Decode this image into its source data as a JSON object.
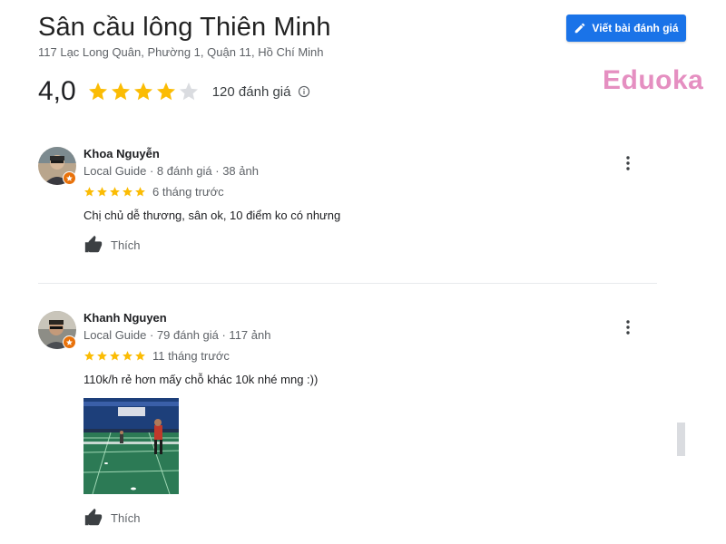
{
  "place": {
    "title": "Sân cầu lông Thiên Minh",
    "address": "117 Lạc Long Quân, Phường 1, Quận 11, Hồ Chí Minh",
    "rating": "4,0",
    "rating_value": 4.0,
    "review_count": "120 đánh giá"
  },
  "actions": {
    "write_review_label": "Viết bài đánh giá"
  },
  "watermark": "Eduoka",
  "reviews": [
    {
      "name": "Khoa Nguyễn",
      "meta": "Local Guide · 8 đánh giá · 38 ảnh",
      "stars": 5,
      "time": "6 tháng trước",
      "text": "Chị chủ dễ thương, sân ok, 10 điểm ko có nhưng",
      "like_label": "Thích"
    },
    {
      "name": "Khanh Nguyen",
      "meta": "Local Guide · 79 đánh giá · 117 ảnh",
      "stars": 5,
      "time": "11 tháng trước",
      "text": "110k/h rẻ hơn mấy chỗ khác 10k nhé mng :))",
      "like_label": "Thích",
      "has_photo": true
    }
  ],
  "colors": {
    "star": "#fbbc04",
    "star_empty": "#dadce0",
    "button": "#1a73e8",
    "badge": "#e8710a",
    "watermark": "#e58fc1"
  },
  "icons": [
    "edit-icon",
    "star-icon",
    "info-icon",
    "local-guide-badge-icon",
    "more-vert-icon",
    "thumb-up-icon"
  ]
}
